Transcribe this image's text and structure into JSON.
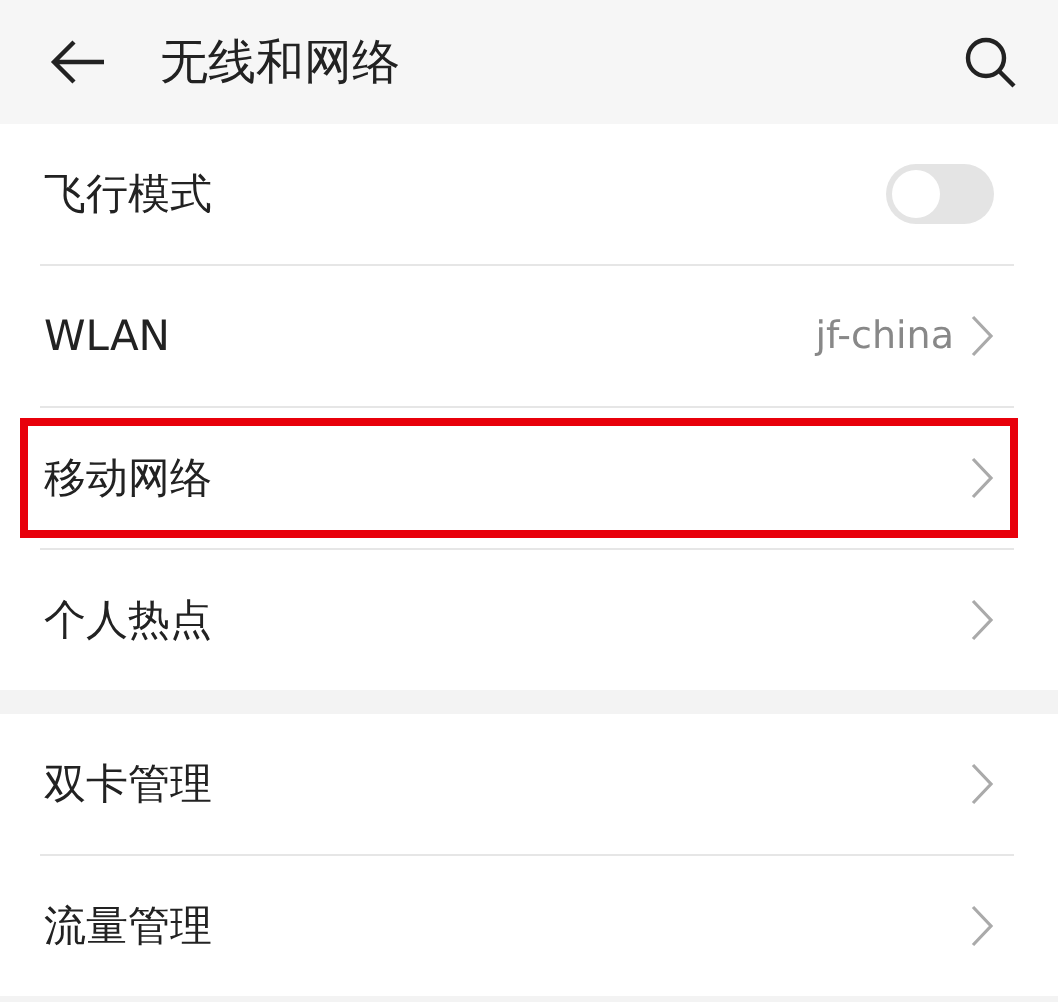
{
  "header": {
    "title": "无线和网络"
  },
  "groups": [
    {
      "items": [
        {
          "kind": "toggle",
          "label": "飞行模式",
          "on": false,
          "highlighted": false
        },
        {
          "kind": "link",
          "label": "WLAN",
          "value": "jf-china",
          "highlighted": false
        },
        {
          "kind": "link",
          "label": "移动网络",
          "highlighted": true
        },
        {
          "kind": "link",
          "label": "个人热点",
          "highlighted": false
        }
      ]
    },
    {
      "items": [
        {
          "kind": "link",
          "label": "双卡管理",
          "highlighted": false
        },
        {
          "kind": "link",
          "label": "流量管理",
          "highlighted": false
        }
      ]
    }
  ]
}
